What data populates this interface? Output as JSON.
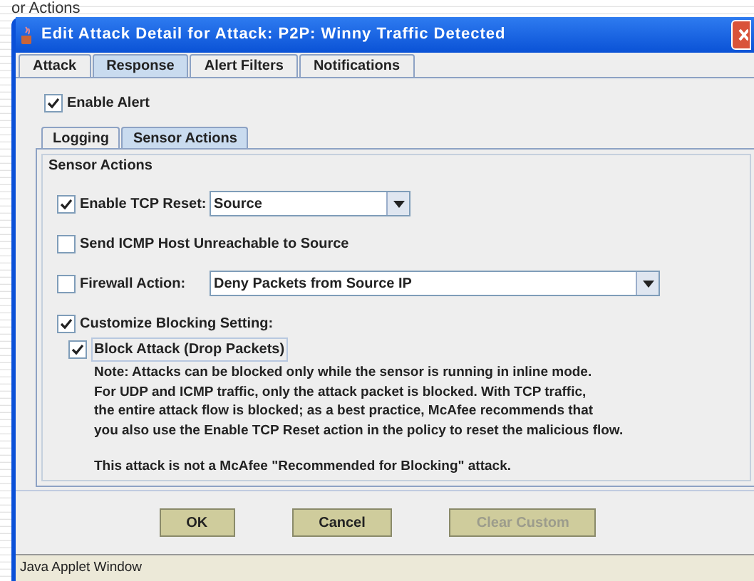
{
  "background_heading": "or Actions",
  "window": {
    "title": "Edit Attack Detail for Attack: P2P: Winny Traffic Detected"
  },
  "tabs": [
    {
      "label": "Attack",
      "selected": false
    },
    {
      "label": "Response",
      "selected": true
    },
    {
      "label": "Alert Filters",
      "selected": false
    },
    {
      "label": "Notifications",
      "selected": false
    }
  ],
  "enable_alert": {
    "label": "Enable Alert",
    "checked": true
  },
  "sub_tabs": [
    {
      "label": "Logging",
      "selected": false
    },
    {
      "label": "Sensor Actions",
      "selected": true
    }
  ],
  "group": {
    "title": "Sensor Actions",
    "rows": [
      {
        "kind": "select",
        "label": "Enable TCP Reset:",
        "checked": true,
        "value": "Source",
        "wide": false
      },
      {
        "kind": "check",
        "label": "Send ICMP Host Unreachable to Source",
        "checked": false
      },
      {
        "kind": "select",
        "label": "Firewall Action:",
        "checked": false,
        "value": "Deny Packets from Source IP",
        "wide": true
      },
      {
        "kind": "check",
        "label": "Customize Blocking Setting:",
        "checked": true
      }
    ],
    "block_attack": {
      "label": "Block Attack (Drop Packets)",
      "checked": true
    },
    "note_lines": [
      "Note: Attacks can be blocked only while the sensor is running in inline mode.",
      "For UDP and ICMP traffic, only the attack packet is blocked. With TCP traffic,",
      "the entire attack flow is blocked; as a best practice, McAfee recommends that",
      "you also use the Enable TCP Reset action in the policy to reset the malicious flow."
    ],
    "recommendation": "This attack is not a McAfee \"Recommended for Blocking\" attack."
  },
  "buttons": [
    {
      "label": "OK",
      "disabled": false
    },
    {
      "label": "Cancel",
      "disabled": false
    },
    {
      "label": "Clear Custom",
      "disabled": true
    }
  ],
  "status_bar": "Java Applet Window"
}
